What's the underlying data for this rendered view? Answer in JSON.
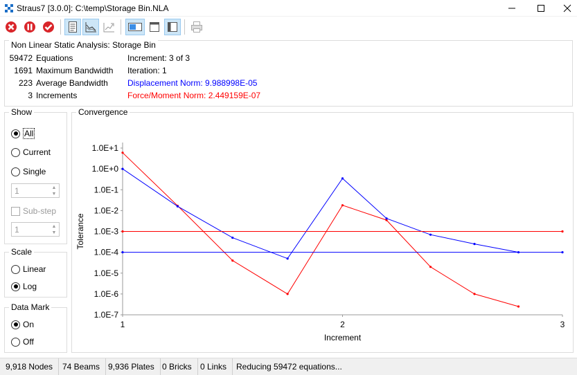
{
  "window": {
    "title": "Straus7 [3.0.0]: C:\\temp\\Storage Bin.NLA"
  },
  "toolbar": {
    "buttons": [
      "stop-icon",
      "pause-icon",
      "check-icon",
      "document-icon",
      "chart-icon",
      "chart-export-icon",
      "layout-horizontal-icon",
      "layout-top-icon",
      "layout-left-icon",
      "print-icon"
    ]
  },
  "info": {
    "heading": "Non Linear Static Analysis: Storage Bin",
    "stats": [
      {
        "value": "59472",
        "label": "Equations"
      },
      {
        "value": "1691",
        "label": "Maximum Bandwidth"
      },
      {
        "value": "223",
        "label": "Average Bandwidth"
      },
      {
        "value": "3",
        "label": "Increments"
      }
    ],
    "increment": "Increment: 3 of 3",
    "iteration": "Iteration: 1",
    "displacement_norm": "Displacement Norm: 9.988998E-05",
    "force_norm": "Force/Moment Norm: 2.449159E-07",
    "displacement_color": "#0000ff",
    "force_color": "#ff0000"
  },
  "show": {
    "title": "Show",
    "all": "All",
    "current": "Current",
    "single": "Single",
    "single_value": "1",
    "substep": "Sub-step",
    "substep_value": "1",
    "selected": "All"
  },
  "scale": {
    "title": "Scale",
    "linear": "Linear",
    "log": "Log",
    "selected": "Log"
  },
  "data_mark": {
    "title": "Data Mark",
    "on": "On",
    "off": "Off",
    "selected": "On"
  },
  "chart_title": "Convergence",
  "chart_data": {
    "type": "line",
    "title": "Convergence",
    "xlabel": "Increment",
    "ylabel": "Tolerance",
    "log_scale_y": true,
    "xlim": [
      1,
      3
    ],
    "ylim_exp": [
      -7,
      1
    ],
    "x_ticks": [
      "1",
      "2",
      "3"
    ],
    "y_ticks": [
      "1.0E-7",
      "1.0E-6",
      "1.0E-5",
      "1.0E-4",
      "1.0E-3",
      "1.0E-2",
      "1.0E-1",
      "1.0E+0",
      "1.0E+1"
    ],
    "series": [
      {
        "color": "#ff0000",
        "x": [
          1,
          1.25,
          1.5,
          1.75,
          2,
          2.2,
          2.4,
          2.6,
          2.8
        ],
        "y": [
          6.0,
          0.017,
          4e-05,
          1e-06,
          0.018,
          0.0035,
          2e-05,
          1e-06,
          2.5e-07
        ]
      },
      {
        "color": "#0000ff",
        "x": [
          1,
          1.25,
          1.5,
          1.75,
          2,
          2.2,
          2.4,
          2.6,
          2.8
        ],
        "y": [
          1.0,
          0.016,
          0.0005,
          5e-05,
          0.35,
          0.0042,
          0.0007,
          0.00025,
          0.0001
        ]
      },
      {
        "color": "#ff0000",
        "x": [
          1,
          3
        ],
        "y": [
          0.001,
          0.001
        ]
      },
      {
        "color": "#0000ff",
        "x": [
          1,
          3
        ],
        "y": [
          0.0001,
          0.0001
        ]
      }
    ],
    "grid": false
  },
  "status": {
    "nodes": "9,918 Nodes",
    "beams": "74 Beams",
    "plates": "9,936 Plates",
    "bricks": "0 Bricks",
    "links": "0 Links",
    "message": "Reducing 59472 equations..."
  }
}
